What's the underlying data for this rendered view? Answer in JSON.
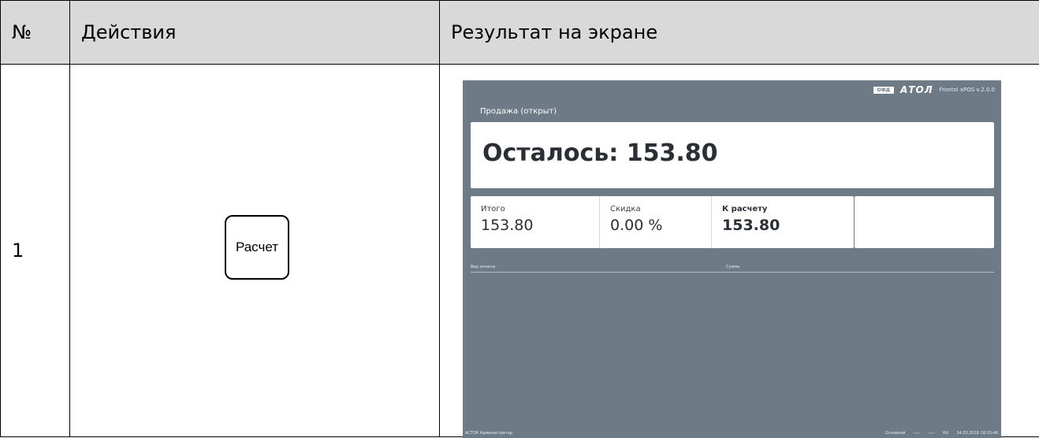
{
  "table": {
    "headers": [
      "№",
      "Действия",
      "Результат на экране"
    ],
    "row": {
      "num": "1",
      "action_key": "Расчет"
    }
  },
  "screen": {
    "ofd_badge": "ОФД",
    "logo": "АТОЛ",
    "version": "Frontol xPOS v.2.0.0",
    "status": "Продажа (открыт)",
    "remaining": "Осталось: 153.80",
    "totals": {
      "total_label": "Итого",
      "total_value": "153.80",
      "discount_label": "Скидка",
      "discount_value": "0.00 %",
      "to_pay_label": "К расчету",
      "to_pay_value": "153.80"
    },
    "payments_header": {
      "type_label": "Вид оплаты",
      "sum_label": "Сумма"
    },
    "statusbar": {
      "left": "АСТОР  Администратор",
      "mode": "Основной",
      "f1": "--:--",
      "f2": "--:--",
      "lang": "RU",
      "datetime": "24.03.2018 18:03:46"
    },
    "colors": {
      "background": "#6e7a86",
      "panel": "#ffffff"
    }
  }
}
